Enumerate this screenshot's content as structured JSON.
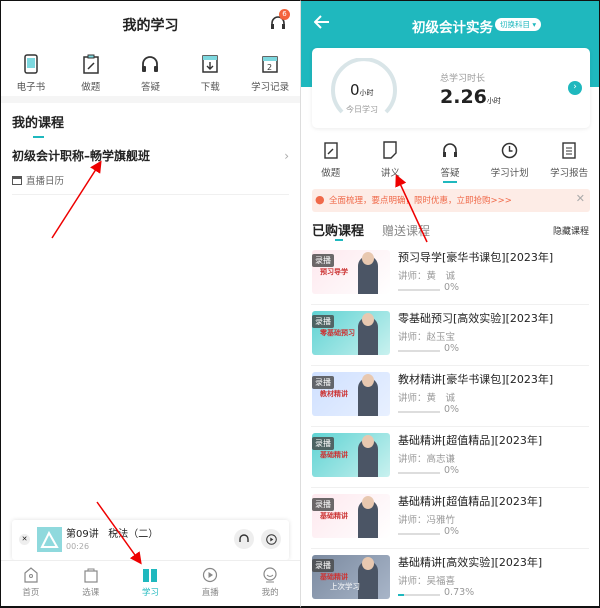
{
  "left": {
    "header": {
      "title": "我的学习",
      "badge": "6"
    },
    "quick": [
      {
        "label": "电子书",
        "icon": "ebook-icon"
      },
      {
        "label": "做题",
        "icon": "exercise-icon"
      },
      {
        "label": "答疑",
        "icon": "headphones-icon"
      },
      {
        "label": "下载",
        "icon": "download-icon"
      },
      {
        "label": "学习记录",
        "icon": "calendar-icon"
      }
    ],
    "section_title": "我的课程",
    "course": {
      "title": "初级会计职称–畅学旗舰班",
      "calendar": "直播日历"
    },
    "player": {
      "lesson": "第09讲",
      "name": "税法（二）",
      "time": "00:26"
    },
    "nav": [
      {
        "label": "首页"
      },
      {
        "label": "选课"
      },
      {
        "label": "学习"
      },
      {
        "label": "直播"
      },
      {
        "label": "我的"
      }
    ]
  },
  "right": {
    "header": {
      "title": "初级会计实务",
      "switch": "切换科目"
    },
    "stats": {
      "today_value": "0",
      "today_unit": "小时",
      "today_label": "今日学习",
      "total_label": "总学习时长",
      "total_value": "2.26",
      "total_unit": "小时"
    },
    "tools": [
      {
        "label": "做题"
      },
      {
        "label": "讲义"
      },
      {
        "label": "答疑"
      },
      {
        "label": "学习计划"
      },
      {
        "label": "学习报告"
      }
    ],
    "promo": "全面梳理，要点明确，限时优惠，立即抢购>>>",
    "tabs": {
      "bought": "已购课程",
      "gift": "赠送课程",
      "hide": "隐藏课程"
    },
    "courses": [
      {
        "title": "预习导学[豪华书课包][2023年]",
        "teacher": "讲师：黄　诚",
        "progress": 0,
        "pct": "0%",
        "tag": "录播",
        "thumb": "预习导学"
      },
      {
        "title": "零基础预习[高效实验][2023年]",
        "teacher": "讲师：赵玉宝",
        "progress": 0,
        "pct": "0%",
        "tag": "录播",
        "thumb": "零基础预习"
      },
      {
        "title": "教材精讲[豪华书课包][2023年]",
        "teacher": "讲师：黄　诚",
        "progress": 0,
        "pct": "0%",
        "tag": "录播",
        "thumb": "教材精讲"
      },
      {
        "title": "基础精讲[超值精品][2023年]",
        "teacher": "讲师：高志谦",
        "progress": 0,
        "pct": "0%",
        "tag": "录播",
        "thumb": "基础精讲"
      },
      {
        "title": "基础精讲[超值精品][2023年]",
        "teacher": "讲师：冯雅竹",
        "progress": 0,
        "pct": "0%",
        "tag": "录播",
        "thumb": "基础精讲"
      },
      {
        "title": "基础精讲[高效实验][2023年]",
        "teacher": "讲师：吴福喜",
        "progress": 0.0073,
        "pct": "0.73%",
        "tag": "录播",
        "thumb": "基础精讲",
        "last": "上次学习"
      }
    ]
  },
  "colors": {
    "accent": "#1fb8be",
    "promo_bg": "#fdece6",
    "promo_text": "#f06a4a"
  }
}
